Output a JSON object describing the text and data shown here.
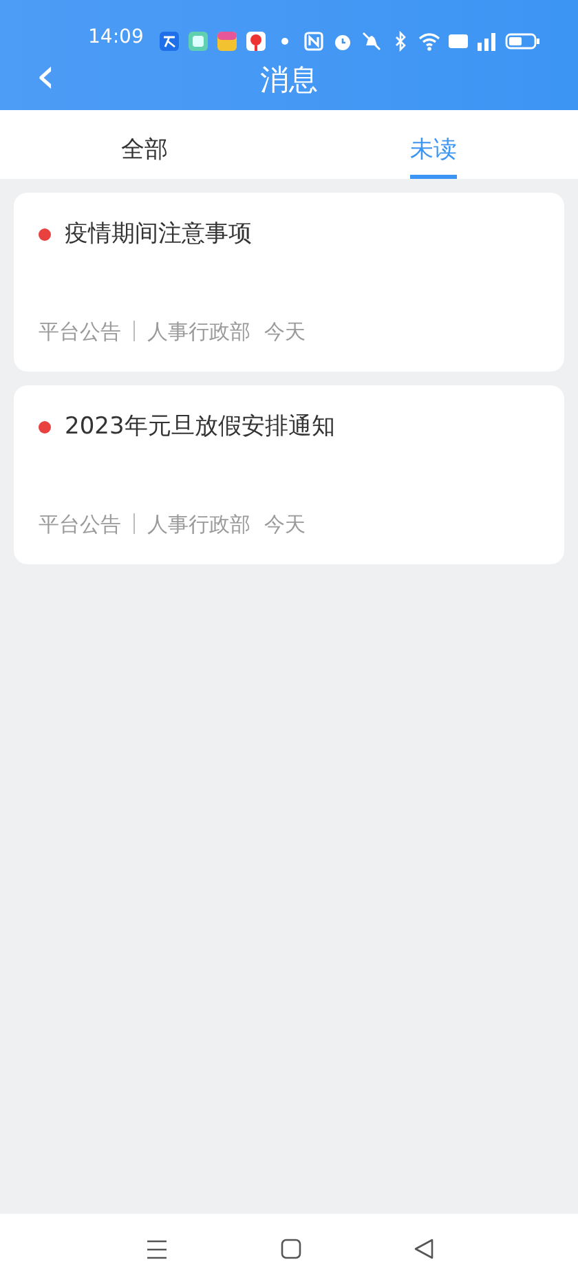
{
  "status_bar": {
    "time": "14:09"
  },
  "header": {
    "back": "‹",
    "title": "消息"
  },
  "tabs": [
    {
      "label": "全部",
      "selected": false
    },
    {
      "label": "未读",
      "selected": true
    }
  ],
  "messages": [
    {
      "title": "疫情期间注意事项",
      "unread": true,
      "category": "平台公告",
      "department": "人事行政部",
      "date": "今天"
    },
    {
      "title": "2023年元旦放假安排通知",
      "unread": true,
      "category": "平台公告",
      "department": "人事行政部",
      "date": "今天"
    }
  ]
}
